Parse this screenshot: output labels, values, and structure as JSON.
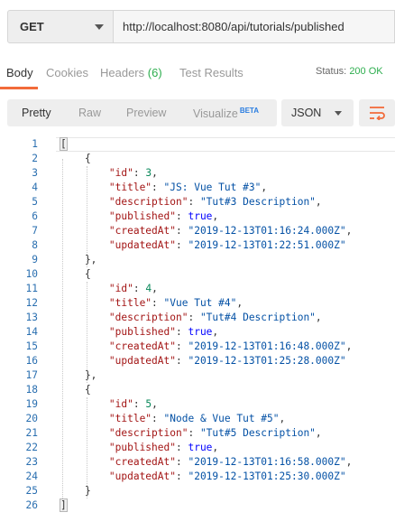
{
  "request": {
    "method": "GET",
    "url": "http://localhost:8080/api/tutorials/published"
  },
  "response_tabs": [
    {
      "label": "Body",
      "active": true
    },
    {
      "label": "Cookies",
      "active": false
    },
    {
      "label": "Headers",
      "count": "(6)",
      "active": false
    },
    {
      "label": "Test Results",
      "active": false
    }
  ],
  "status": {
    "label": "Status:",
    "code": "200 OK"
  },
  "view_options": [
    {
      "label": "Pretty",
      "active": true
    },
    {
      "label": "Raw",
      "active": false
    },
    {
      "label": "Preview",
      "active": false
    },
    {
      "label": "Visualize",
      "badge": "BETA",
      "active": false
    }
  ],
  "format": "JSON",
  "wrap_icon": "wrap-lines-icon",
  "colors": {
    "accent": "#f26b3a",
    "status_ok": "#2eae4f",
    "line_number": "#2a6fb0",
    "json_key": "#a31515",
    "json_string": "#0451a5",
    "json_number": "#09885a",
    "json_keyword": "#0000ff"
  },
  "body_lines": [
    [
      [
        "p",
        "["
      ]
    ],
    [
      [
        "p",
        "    {"
      ]
    ],
    [
      [
        "p",
        "        "
      ],
      [
        "k",
        "\"id\""
      ],
      [
        "p",
        ": "
      ],
      [
        "n",
        "3"
      ],
      [
        "p",
        ","
      ]
    ],
    [
      [
        "p",
        "        "
      ],
      [
        "k",
        "\"title\""
      ],
      [
        "p",
        ": "
      ],
      [
        "s",
        "\"JS: Vue Tut #3\""
      ],
      [
        "p",
        ","
      ]
    ],
    [
      [
        "p",
        "        "
      ],
      [
        "k",
        "\"description\""
      ],
      [
        "p",
        ": "
      ],
      [
        "s",
        "\"Tut#3 Description\""
      ],
      [
        "p",
        ","
      ]
    ],
    [
      [
        "p",
        "        "
      ],
      [
        "k",
        "\"published\""
      ],
      [
        "p",
        ": "
      ],
      [
        "kw",
        "true"
      ],
      [
        "p",
        ","
      ]
    ],
    [
      [
        "p",
        "        "
      ],
      [
        "k",
        "\"createdAt\""
      ],
      [
        "p",
        ": "
      ],
      [
        "s",
        "\"2019-12-13T01:16:24.000Z\""
      ],
      [
        "p",
        ","
      ]
    ],
    [
      [
        "p",
        "        "
      ],
      [
        "k",
        "\"updatedAt\""
      ],
      [
        "p",
        ": "
      ],
      [
        "s",
        "\"2019-12-13T01:22:51.000Z\""
      ]
    ],
    [
      [
        "p",
        "    },"
      ]
    ],
    [
      [
        "p",
        "    {"
      ]
    ],
    [
      [
        "p",
        "        "
      ],
      [
        "k",
        "\"id\""
      ],
      [
        "p",
        ": "
      ],
      [
        "n",
        "4"
      ],
      [
        "p",
        ","
      ]
    ],
    [
      [
        "p",
        "        "
      ],
      [
        "k",
        "\"title\""
      ],
      [
        "p",
        ": "
      ],
      [
        "s",
        "\"Vue Tut #4\""
      ],
      [
        "p",
        ","
      ]
    ],
    [
      [
        "p",
        "        "
      ],
      [
        "k",
        "\"description\""
      ],
      [
        "p",
        ": "
      ],
      [
        "s",
        "\"Tut#4 Description\""
      ],
      [
        "p",
        ","
      ]
    ],
    [
      [
        "p",
        "        "
      ],
      [
        "k",
        "\"published\""
      ],
      [
        "p",
        ": "
      ],
      [
        "kw",
        "true"
      ],
      [
        "p",
        ","
      ]
    ],
    [
      [
        "p",
        "        "
      ],
      [
        "k",
        "\"createdAt\""
      ],
      [
        "p",
        ": "
      ],
      [
        "s",
        "\"2019-12-13T01:16:48.000Z\""
      ],
      [
        "p",
        ","
      ]
    ],
    [
      [
        "p",
        "        "
      ],
      [
        "k",
        "\"updatedAt\""
      ],
      [
        "p",
        ": "
      ],
      [
        "s",
        "\"2019-12-13T01:25:28.000Z\""
      ]
    ],
    [
      [
        "p",
        "    },"
      ]
    ],
    [
      [
        "p",
        "    {"
      ]
    ],
    [
      [
        "p",
        "        "
      ],
      [
        "k",
        "\"id\""
      ],
      [
        "p",
        ": "
      ],
      [
        "n",
        "5"
      ],
      [
        "p",
        ","
      ]
    ],
    [
      [
        "p",
        "        "
      ],
      [
        "k",
        "\"title\""
      ],
      [
        "p",
        ": "
      ],
      [
        "s",
        "\"Node & Vue Tut #5\""
      ],
      [
        "p",
        ","
      ]
    ],
    [
      [
        "p",
        "        "
      ],
      [
        "k",
        "\"description\""
      ],
      [
        "p",
        ": "
      ],
      [
        "s",
        "\"Tut#5 Description\""
      ],
      [
        "p",
        ","
      ]
    ],
    [
      [
        "p",
        "        "
      ],
      [
        "k",
        "\"published\""
      ],
      [
        "p",
        ": "
      ],
      [
        "kw",
        "true"
      ],
      [
        "p",
        ","
      ]
    ],
    [
      [
        "p",
        "        "
      ],
      [
        "k",
        "\"createdAt\""
      ],
      [
        "p",
        ": "
      ],
      [
        "s",
        "\"2019-12-13T01:16:58.000Z\""
      ],
      [
        "p",
        ","
      ]
    ],
    [
      [
        "p",
        "        "
      ],
      [
        "k",
        "\"updatedAt\""
      ],
      [
        "p",
        ": "
      ],
      [
        "s",
        "\"2019-12-13T01:25:30.000Z\""
      ]
    ],
    [
      [
        "p",
        "    }"
      ]
    ],
    [
      [
        "p",
        "]"
      ]
    ]
  ]
}
